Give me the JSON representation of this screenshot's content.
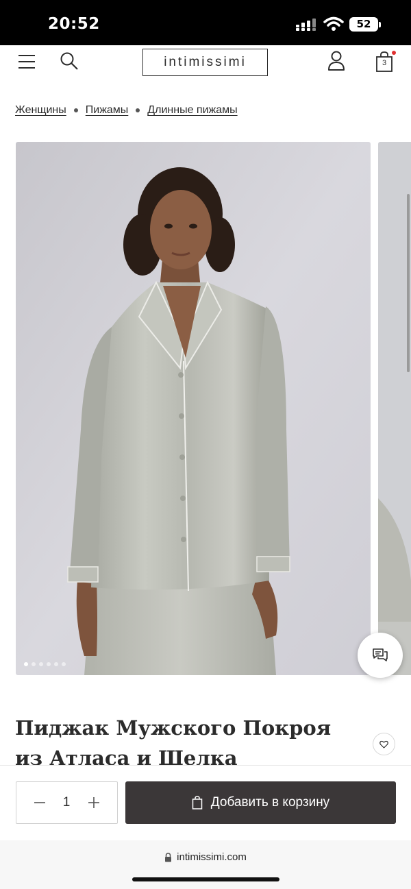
{
  "status_bar": {
    "time": "20:52",
    "battery": "52",
    "icons": [
      "signal-icon",
      "wifi-icon",
      "battery-icon"
    ]
  },
  "header": {
    "logo": "intimissimi",
    "bag_count": "3",
    "icons": [
      "menu-icon",
      "search-icon",
      "account-icon",
      "bag-icon"
    ],
    "notification_color": "#e03131"
  },
  "breadcrumb": {
    "items": [
      "Женщины",
      "Пижамы",
      "Длинные пижамы"
    ]
  },
  "gallery": {
    "image_count": 6,
    "active_index": 0,
    "icons": [
      "chat-icon"
    ]
  },
  "product": {
    "title": "Пиджак Мужского Покроя из Атласа и Шелка",
    "icons": [
      "heart-icon"
    ]
  },
  "cart_bar": {
    "quantity": "1",
    "add_label": "Добавить в корзину",
    "button_color": "#3b3738",
    "icons": [
      "minus-icon",
      "plus-icon",
      "bag-icon"
    ]
  },
  "browser": {
    "url": "intimissimi.com",
    "icons": [
      "lock-icon"
    ]
  }
}
